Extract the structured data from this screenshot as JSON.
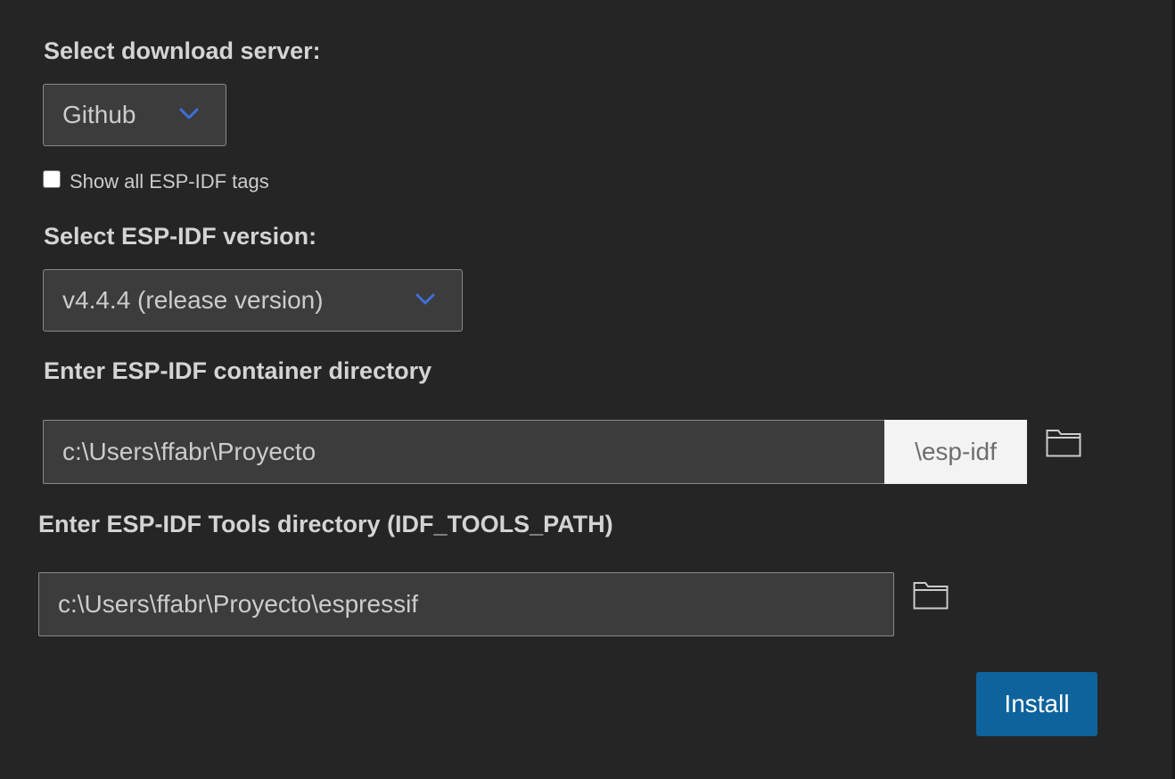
{
  "download_server": {
    "label": "Select download server:",
    "selected": "Github"
  },
  "show_all_tags": {
    "label": "Show all ESP-IDF tags",
    "checked": false
  },
  "idf_version": {
    "label": "Select ESP-IDF version:",
    "selected": "v4.4.4 (release version)"
  },
  "container_dir": {
    "label": "Enter ESP-IDF container directory",
    "value": "c:\\Users\\ffabr\\Proyecto",
    "suffix": "\\esp-idf"
  },
  "tools_dir": {
    "label": "Enter ESP-IDF Tools directory (IDF_TOOLS_PATH)",
    "value": "c:\\Users\\ffabr\\Proyecto\\espressif"
  },
  "install_button": {
    "label": "Install"
  },
  "colors": {
    "background": "#252526",
    "input_background": "#3c3c3c",
    "chevron": "#3f6fd8",
    "button": "#0e639c"
  },
  "icons": [
    "chevron-down-icon",
    "folder-icon"
  ]
}
